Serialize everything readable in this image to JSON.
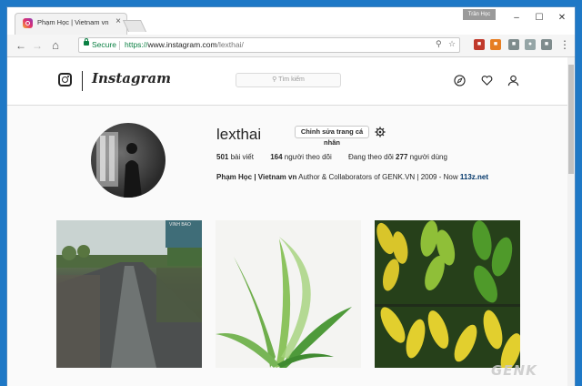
{
  "browser": {
    "tab_title": "Phạm Học | Vietnam vn",
    "profile_badge": "Trần Học",
    "secure_label": "Secure",
    "url_scheme": "https://",
    "url_host": "www.instagram.com",
    "url_path": "/lexthai/"
  },
  "instagram": {
    "logo_text": "Instagram",
    "search_placeholder": "Tìm kiếm",
    "profile": {
      "username": "lexthai",
      "edit_button": "Chỉnh sửa trang cá nhân",
      "posts_count": "501",
      "posts_label": "bài viết",
      "followers_count": "164",
      "followers_label": "người theo dõi",
      "following_prefix": "Đang theo dõi",
      "following_count": "277",
      "following_label": "người dùng",
      "full_name": "Phạm Học | Vietnam vn",
      "bio_text": "Author & Collaborators of GENK.VN | 2009 - Now",
      "bio_link": "113z.net"
    },
    "photo_sign_text": "VINH BAO"
  },
  "watermark": "GENK",
  "colors": {
    "secure_green": "#0b8043",
    "link_blue": "#003569",
    "desktop_blue": "#1e78c6"
  }
}
